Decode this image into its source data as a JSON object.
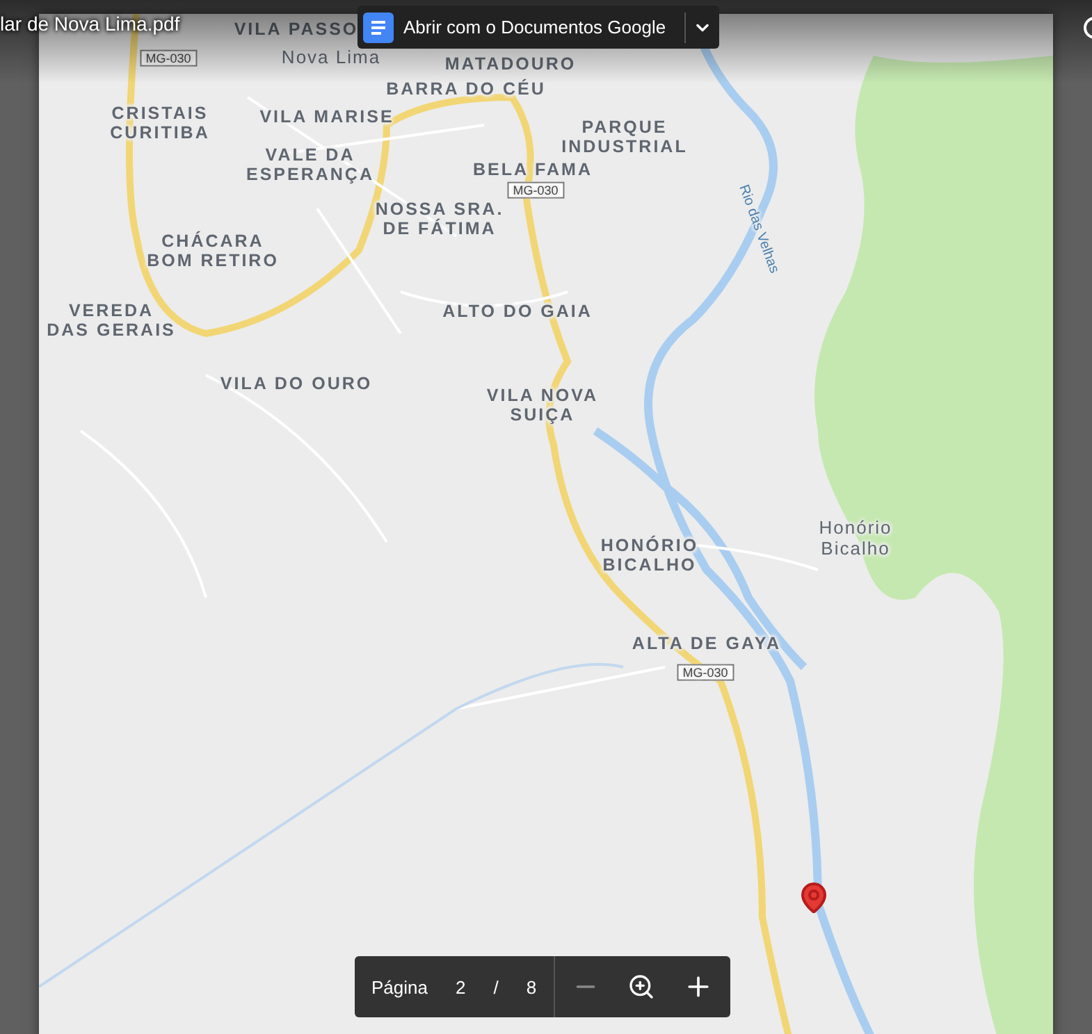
{
  "file_title": "lar de Nova Lima.pdf",
  "open_with": {
    "label": "Abrir com o Documentos Google"
  },
  "map": {
    "labels": [
      {
        "kind": "place",
        "text": "VILA PASSO"
      },
      {
        "kind": "place",
        "text": "MATADOURO"
      },
      {
        "kind": "town",
        "text": "Nova Lima"
      },
      {
        "kind": "place",
        "text": "BARRA DO CÉU"
      },
      {
        "kind": "place",
        "text": "CRISTAIS\nCURITIBA"
      },
      {
        "kind": "place",
        "text": "VILA MARISE"
      },
      {
        "kind": "place",
        "text": "PARQUE\nINDUSTRIAL"
      },
      {
        "kind": "place",
        "text": "VALE DA\nESPERANÇA"
      },
      {
        "kind": "place",
        "text": "BELA FAMA"
      },
      {
        "kind": "place",
        "text": "NOSSA SRA.\nDE FÁTIMA"
      },
      {
        "kind": "place",
        "text": "CHÁCARA\nBOM RETIRO"
      },
      {
        "kind": "place",
        "text": "VEREDA\nDAS GERAIS"
      },
      {
        "kind": "place",
        "text": "ALTO DO GAIA"
      },
      {
        "kind": "place",
        "text": "VILA DO OURO"
      },
      {
        "kind": "place",
        "text": "VILA NOVA\nSUIÇA"
      },
      {
        "kind": "place",
        "text": "HONÓRIO\nBICALHO"
      },
      {
        "kind": "town",
        "text": "Honório\nBicalho"
      },
      {
        "kind": "place",
        "text": "ALTA DE GAYA"
      },
      {
        "kind": "river",
        "text": "Rio das Velhas"
      },
      {
        "kind": "road",
        "text": "MG-030"
      },
      {
        "kind": "road",
        "text": "MG-030"
      },
      {
        "kind": "road",
        "text": "MG-030"
      }
    ]
  },
  "pager": {
    "label": "Página",
    "current": "2",
    "separator": "/",
    "total": "8"
  }
}
